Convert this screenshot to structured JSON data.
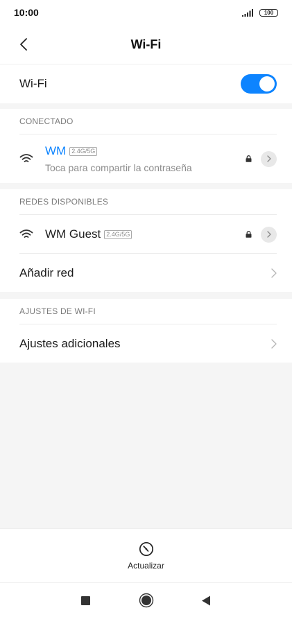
{
  "status_bar": {
    "time": "10:00",
    "battery": "100"
  },
  "header": {
    "title": "Wi-Fi"
  },
  "wifi_toggle": {
    "label": "Wi-Fi",
    "on": true
  },
  "connected": {
    "header": "CONECTADO",
    "network": {
      "name": "WM",
      "band": "2.4G/5G",
      "subtitle": "Toca para compartir la contraseña"
    }
  },
  "available": {
    "header": "REDES DISPONIBLES",
    "networks": [
      {
        "name": "WM Guest",
        "band": "2.4G/5G"
      }
    ],
    "add_network": "Añadir red"
  },
  "settings": {
    "header": "AJUSTES DE WI-FI",
    "additional": "Ajustes adicionales"
  },
  "bottom": {
    "refresh_label": "Actualizar"
  },
  "colors": {
    "accent": "#0d84ff"
  }
}
